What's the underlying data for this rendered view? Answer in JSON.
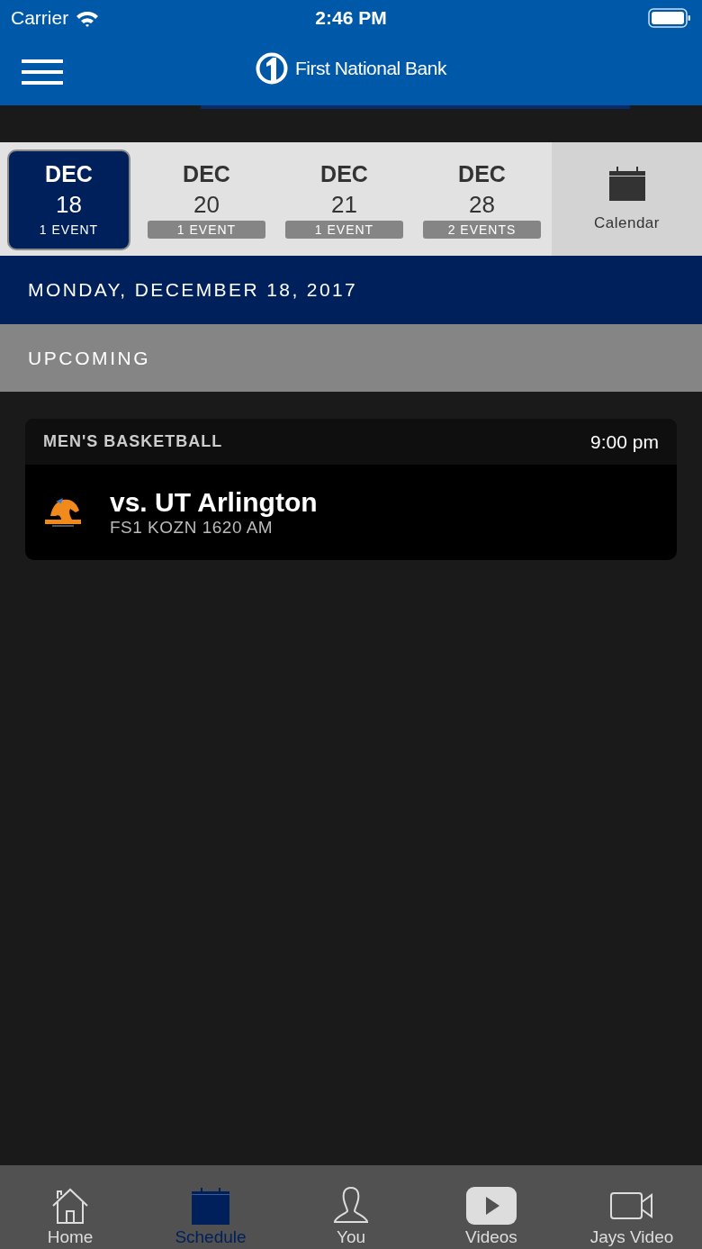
{
  "status_bar": {
    "carrier": "Carrier",
    "time": "2:46 PM"
  },
  "header": {
    "brand": "First National Bank"
  },
  "dates": [
    {
      "month": "DEC",
      "day": "18",
      "events": "1 EVENT",
      "selected": true
    },
    {
      "month": "DEC",
      "day": "20",
      "events": "1 EVENT",
      "selected": false
    },
    {
      "month": "DEC",
      "day": "21",
      "events": "1 EVENT",
      "selected": false
    },
    {
      "month": "DEC",
      "day": "28",
      "events": "2 EVENTS",
      "selected": false
    }
  ],
  "calendar_button": "Calendar",
  "date_heading": "MONDAY, DECEMBER 18, 2017",
  "section_heading": "UPCOMING",
  "events": [
    {
      "sport": "MEN'S BASKETBALL",
      "time": "9:00 pm",
      "opponent": "vs. UT Arlington",
      "broadcast": "FS1 KOZN 1620 AM"
    }
  ],
  "tab_bar": [
    {
      "kind": "home",
      "label": "Home",
      "selected": false
    },
    {
      "kind": "schedule",
      "label": "Schedule",
      "selected": true
    },
    {
      "kind": "you",
      "label": "You",
      "selected": false
    },
    {
      "kind": "videos",
      "label": "Videos",
      "selected": false
    },
    {
      "kind": "video",
      "label": "Jays Video",
      "selected": false
    }
  ]
}
